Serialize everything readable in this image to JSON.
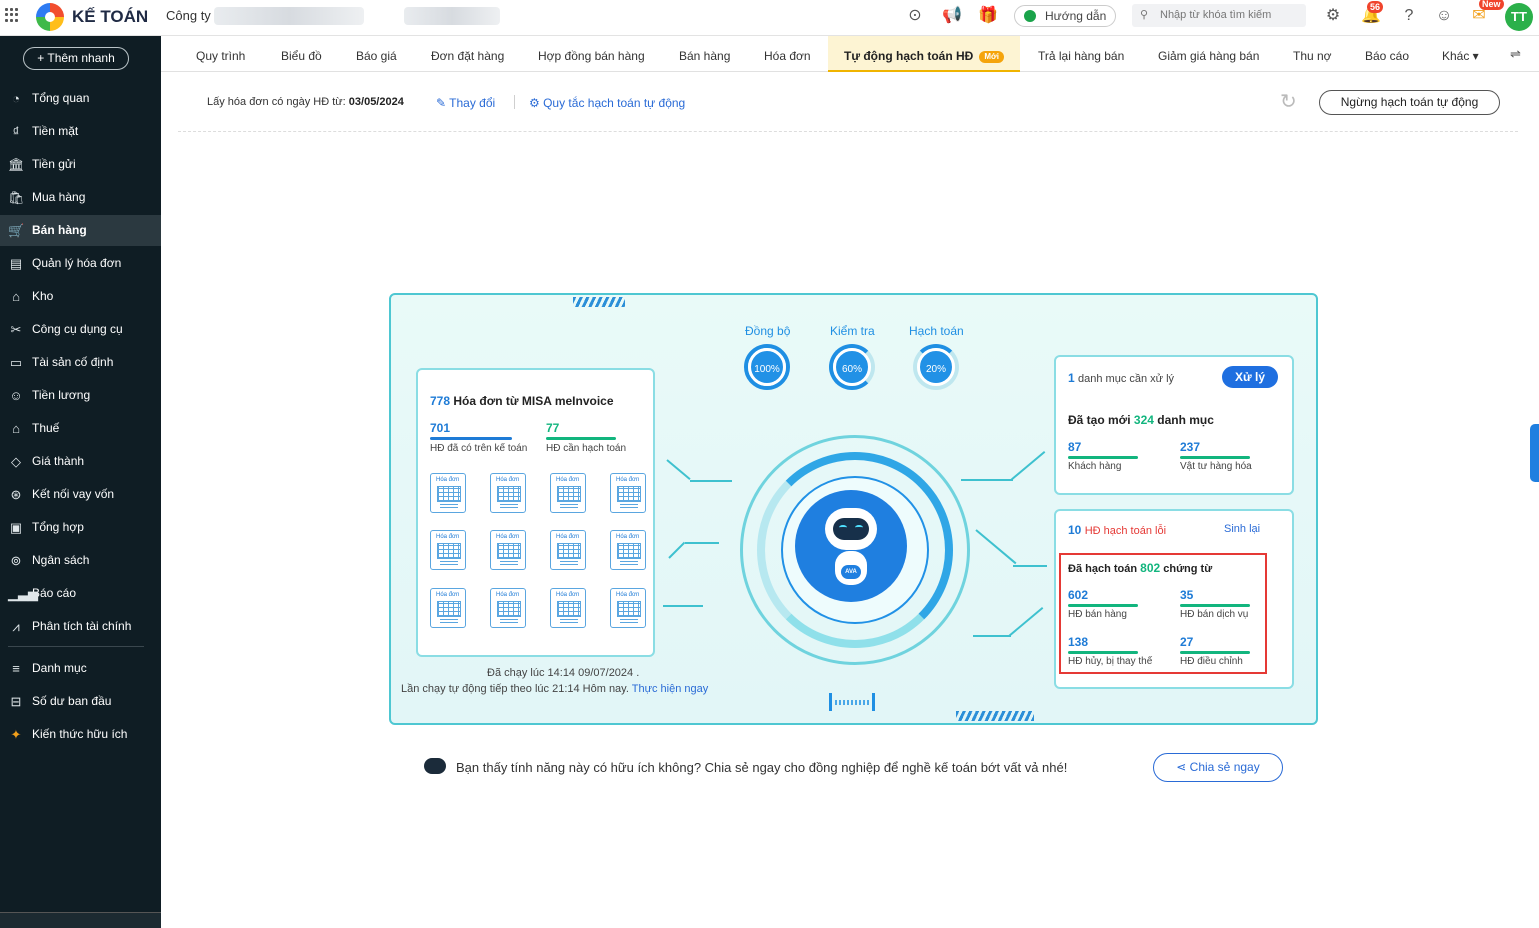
{
  "app": {
    "brand": "KẾ TOÁN",
    "company_label": "Công ty",
    "guide": "Hướng dẫn",
    "search_placeholder": "Nhập từ khóa tìm kiếm",
    "notif_count": "56",
    "new_tag": "New",
    "avatar": "TT"
  },
  "sidebar": {
    "quick_add": "+ Thêm nhanh",
    "items": [
      {
        "label": "Tổng quan",
        "icon": "overview-icon",
        "glyph": "◔"
      },
      {
        "label": "Tiền mặt",
        "icon": "cash-icon",
        "glyph": "₫"
      },
      {
        "label": "Tiền gửi",
        "icon": "bank-icon",
        "glyph": "🏛"
      },
      {
        "label": "Mua hàng",
        "icon": "shopping-bag-icon",
        "glyph": "🛍"
      },
      {
        "label": "Bán hàng",
        "icon": "cart-icon",
        "glyph": "🛒"
      },
      {
        "label": "Quản lý hóa đơn",
        "icon": "invoice-icon",
        "glyph": "▤"
      },
      {
        "label": "Kho",
        "icon": "warehouse-icon",
        "glyph": "⌂"
      },
      {
        "label": "Công cụ dụng cụ",
        "icon": "tools-icon",
        "glyph": "✂"
      },
      {
        "label": "Tài sản cố định",
        "icon": "asset-icon",
        "glyph": "▭"
      },
      {
        "label": "Tiền lương",
        "icon": "payroll-icon",
        "glyph": "☺"
      },
      {
        "label": "Thuế",
        "icon": "tax-icon",
        "glyph": "⌂"
      },
      {
        "label": "Giá thành",
        "icon": "price-tag-icon",
        "glyph": "◇"
      },
      {
        "label": "Kết nối vay vốn",
        "icon": "loan-icon",
        "glyph": "⊛"
      },
      {
        "label": "Tổng hợp",
        "icon": "summary-icon",
        "glyph": "▣"
      },
      {
        "label": "Ngân sách",
        "icon": "budget-icon",
        "glyph": "⊚"
      },
      {
        "label": "Báo cáo",
        "icon": "report-icon",
        "glyph": "▁▃▅"
      },
      {
        "label": "Phân tích tài chính",
        "icon": "analysis-icon",
        "glyph": "⩘"
      },
      {
        "label": "Danh mục",
        "icon": "list-icon",
        "glyph": "≡"
      },
      {
        "label": "Số dư ban đầu",
        "icon": "balance-icon",
        "glyph": "⊟"
      },
      {
        "label": "Kiến thức hữu ích",
        "icon": "knowledge-icon",
        "glyph": "✦"
      }
    ]
  },
  "tabs": [
    "Quy trình",
    "Biểu đồ",
    "Báo giá",
    "Đơn đặt hàng",
    "Hợp đồng bán hàng",
    "Bán hàng",
    "Hóa đơn",
    "Tự động hạch toán HĐ",
    "Trả lại hàng bán",
    "Giảm giá hàng bán",
    "Thu nợ",
    "Báo cáo",
    "Khác ▾"
  ],
  "active_tab_new": "Mới",
  "toolbar": {
    "prefix": "Lấy hóa đơn có ngày HĐ từ:",
    "date": "03/05/2024",
    "change": "Thay đổi",
    "rules": "Quy tắc hạch toán tự động",
    "stop": "Ngừng hạch toán tự động"
  },
  "stages": [
    {
      "label": "Đồng bộ",
      "pct": "100%"
    },
    {
      "label": "Kiểm tra",
      "pct": "60%"
    },
    {
      "label": "Hạch toán",
      "pct": "20%"
    }
  ],
  "invoices": {
    "total": "778",
    "title": "Hóa đơn từ MISA meInvoice",
    "a_val": "701",
    "a_label": "HĐ đã có trên kế toán",
    "b_val": "77",
    "b_label": "HĐ cần hạch toán",
    "doc_label": "Hóa đơn"
  },
  "run": {
    "last": "Đã chạy lúc 14:14 09/07/2024 .",
    "next": "Lần chạy tự động tiếp theo lúc 21:14 Hôm nay.",
    "now": "Thực hiện ngay"
  },
  "categories": {
    "count": "1",
    "label": "danh mục cần xử lý",
    "btn": "Xử lý",
    "created_prefix": "Đã tạo mới",
    "created": "324",
    "created_suffix": "danh mục",
    "c1_val": "87",
    "c1_label": "Khách hàng",
    "c2_val": "237",
    "c2_label": "Vật tư hàng hóa"
  },
  "errors": {
    "count": "10",
    "label": "HĐ hạch toán lỗi",
    "regen": "Sinh lại",
    "done_prefix": "Đã hạch toán",
    "done": "802",
    "done_suffix": "chứng từ",
    "items": [
      {
        "val": "602",
        "label": "HĐ bán hàng"
      },
      {
        "val": "35",
        "label": "HĐ bán dịch vụ"
      },
      {
        "val": "138",
        "label": "HĐ hủy, bị thay thế"
      },
      {
        "val": "27",
        "label": "HĐ điều chỉnh"
      }
    ]
  },
  "robot": {
    "badge": "AVA"
  },
  "feedback": {
    "text": "Bạn thấy tính năng này có hữu ích không? Chia sẻ ngay cho đồng nghiệp để nghề kế toán bớt vất vả nhé!",
    "share": "Chia sẻ ngay"
  }
}
